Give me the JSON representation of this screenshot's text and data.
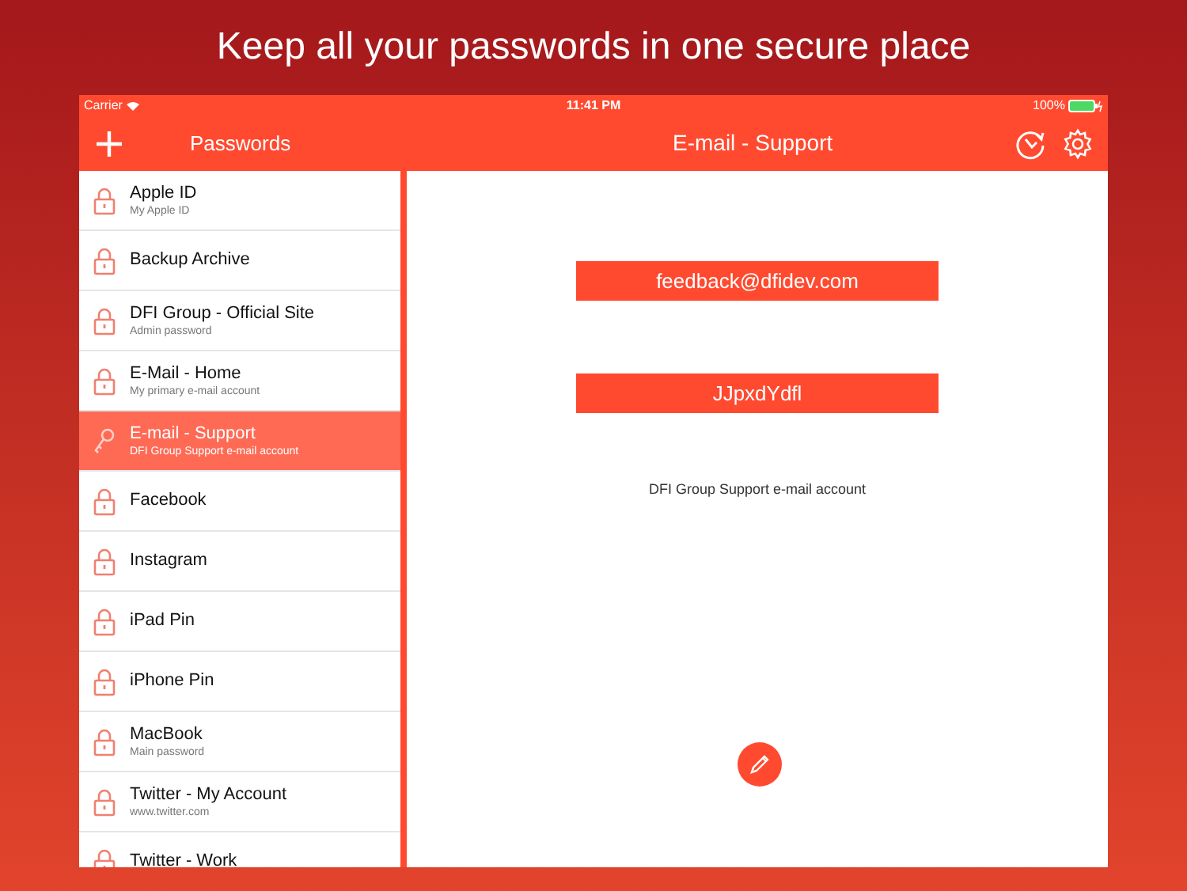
{
  "headline": "Keep all your passwords in one secure place",
  "status_bar": {
    "carrier": "Carrier",
    "time": "11:41 PM",
    "battery": "100%"
  },
  "nav_bar": {
    "left_title": "Passwords",
    "title": "E-mail - Support"
  },
  "sidebar": {
    "items": [
      {
        "title": "Apple ID",
        "subtitle": "My Apple ID",
        "selected": false
      },
      {
        "title": "Backup Archive",
        "selected": false
      },
      {
        "title": "DFI Group - Official Site",
        "subtitle": "Admin password",
        "selected": false
      },
      {
        "title": "E-Mail - Home",
        "subtitle": "My primary e-mail account",
        "selected": false
      },
      {
        "title": "E-mail - Support",
        "subtitle": "DFI Group Support e-mail account",
        "selected": true
      },
      {
        "title": "Facebook",
        "selected": false
      },
      {
        "title": "Instagram",
        "selected": false
      },
      {
        "title": "iPad Pin",
        "selected": false
      },
      {
        "title": "iPhone Pin",
        "selected": false
      },
      {
        "title": "MacBook",
        "subtitle": "Main password",
        "selected": false
      },
      {
        "title": "Twitter - My Account",
        "subtitle": "www.twitter.com",
        "selected": false
      },
      {
        "title": "Twitter - Work",
        "selected": false
      }
    ]
  },
  "detail": {
    "login": "feedback@dfidev.com",
    "password": "JJpxdYdfl",
    "note": "DFI Group Support e-mail account"
  }
}
